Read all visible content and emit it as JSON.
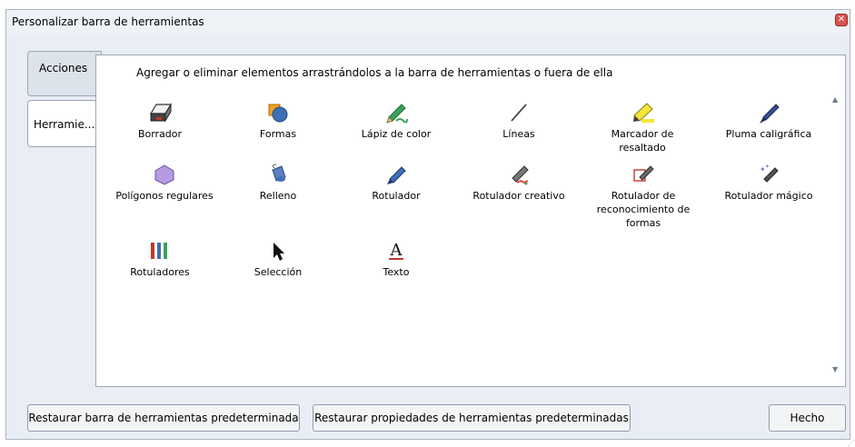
{
  "window": {
    "title": "Personalizar barra de herramientas"
  },
  "tabs": [
    {
      "label": "Acciones",
      "active": false
    },
    {
      "label": "Herramie...",
      "active": true
    }
  ],
  "panel": {
    "instruction": "Agregar o eliminar elementos arrastrándolos a la barra de herramientas o fuera de ella",
    "items": [
      {
        "label": "Borrador",
        "icon": "eraser-icon"
      },
      {
        "label": "Formas",
        "icon": "shapes-icon"
      },
      {
        "label": "Lápiz de color",
        "icon": "color-pencil-icon"
      },
      {
        "label": "Líneas",
        "icon": "line-icon"
      },
      {
        "label": "Marcador de resaltado",
        "icon": "highlighter-icon"
      },
      {
        "label": "Pluma caligráfica",
        "icon": "calligraphy-pen-icon"
      },
      {
        "label": "Polígonos regulares",
        "icon": "polygon-icon"
      },
      {
        "label": "Relleno",
        "icon": "fill-bucket-icon"
      },
      {
        "label": "Rotulador",
        "icon": "pen-icon"
      },
      {
        "label": "Rotulador creativo",
        "icon": "creative-pen-icon"
      },
      {
        "label": "Rotulador de reconocimiento de formas",
        "icon": "shape-recognition-pen-icon"
      },
      {
        "label": "Rotulador mágico",
        "icon": "magic-pen-icon"
      },
      {
        "label": "Rotuladores",
        "icon": "pens-icon"
      },
      {
        "label": "Selección",
        "icon": "cursor-arrow-icon"
      },
      {
        "label": "Texto",
        "icon": "text-icon"
      }
    ]
  },
  "buttons": {
    "restore_toolbar": "Restaurar barra de herramientas predeterminada",
    "restore_properties": "Restaurar propiedades de herramientas predeterminadas",
    "done": "Hecho"
  },
  "colors": {
    "accent_blue": "#3f6fb5",
    "close_red": "#d9534f"
  }
}
